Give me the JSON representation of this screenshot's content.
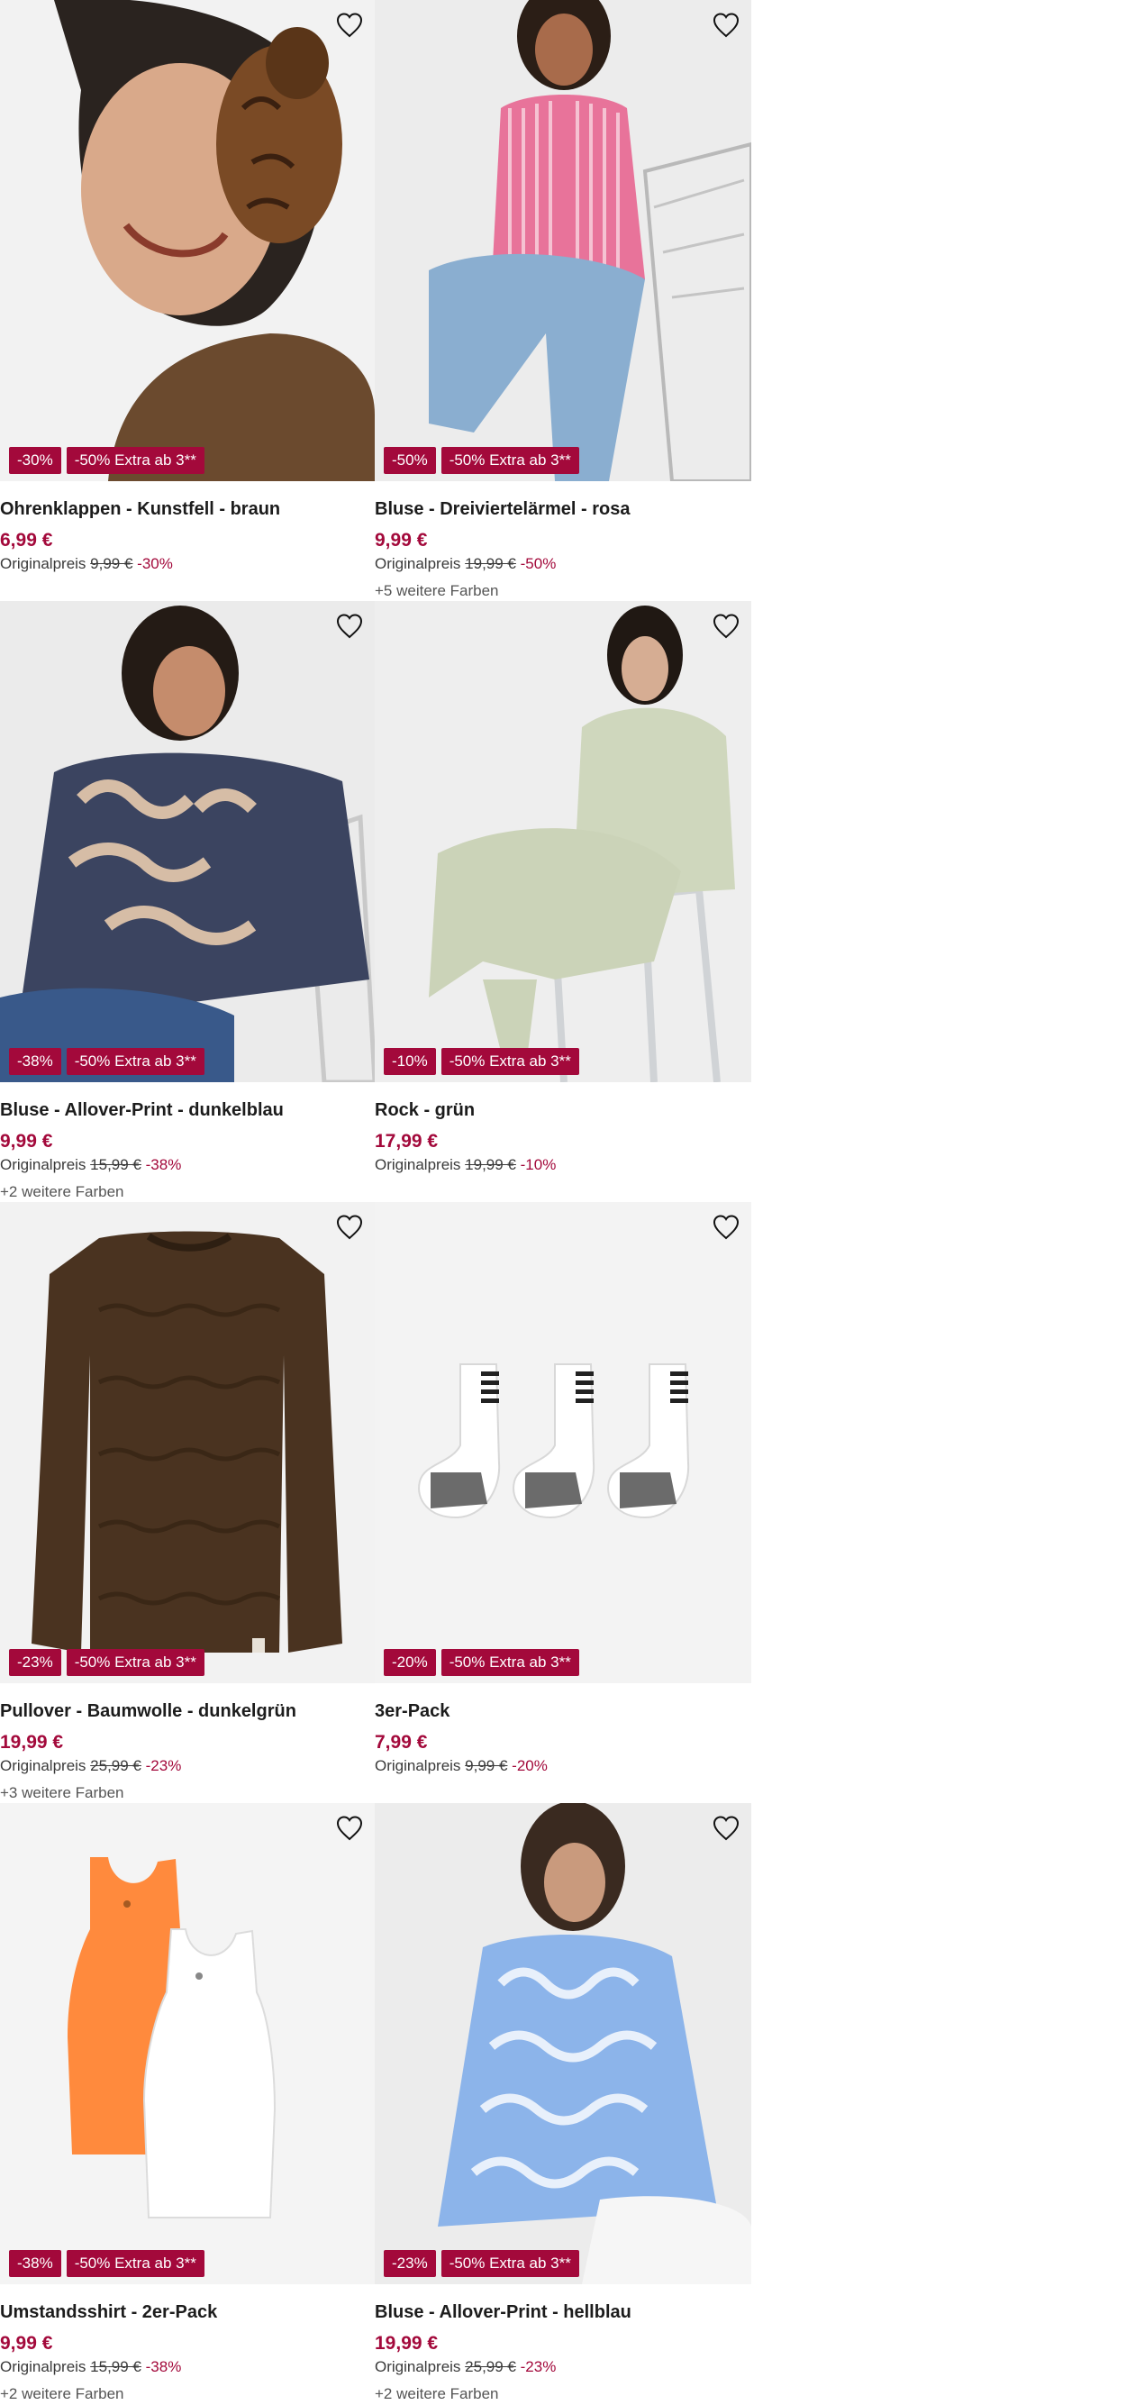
{
  "products": [
    {
      "name": "Ohrenklappen - Kunstfell - braun",
      "price": "6,99 €",
      "original_label": "Originalpreis",
      "original_price": "9,99 €",
      "discount": "-30%",
      "badges": [
        "-30%",
        "-50% Extra ab 3**"
      ],
      "colors": "",
      "image": "earmuffs-photo"
    },
    {
      "name": "Bluse - Dreiviertelärmel - rosa",
      "price": "9,99 €",
      "original_label": "Originalpreis",
      "original_price": "19,99 €",
      "discount": "-50%",
      "badges": [
        "-50%",
        "-50% Extra ab 3**"
      ],
      "colors": "+5 weitere Farben",
      "image": "pink-blouse-photo"
    },
    {
      "name": "Bluse - Allover-Print - dunkelblau",
      "price": "9,99 €",
      "original_label": "Originalpreis",
      "original_price": "15,99 €",
      "discount": "-38%",
      "badges": [
        "-38%",
        "-50% Extra ab 3**"
      ],
      "colors": "+2 weitere Farben",
      "image": "navy-print-blouse-photo"
    },
    {
      "name": "Rock - grün",
      "price": "17,99 €",
      "original_label": "Originalpreis",
      "original_price": "19,99 €",
      "discount": "-10%",
      "badges": [
        "-10%",
        "-50% Extra ab 3**"
      ],
      "colors": "",
      "image": "green-knit-skirt-photo"
    },
    {
      "name": "Pullover - Baumwolle - dunkelgrün",
      "price": "19,99 €",
      "original_label": "Originalpreis",
      "original_price": "25,99 €",
      "discount": "-23%",
      "badges": [
        "-23%",
        "-50% Extra ab 3**"
      ],
      "colors": "+3 weitere Farben",
      "image": "brown-pullover-photo"
    },
    {
      "name": "3er-Pack",
      "price": "7,99 €",
      "original_label": "Originalpreis",
      "original_price": "9,99 €",
      "discount": "-20%",
      "badges": [
        "-20%",
        "-50% Extra ab 3**"
      ],
      "colors": "",
      "image": "socks-photo"
    },
    {
      "name": "Umstandsshirt - 2er-Pack",
      "price": "9,99 €",
      "original_label": "Originalpreis",
      "original_price": "15,99 €",
      "discount": "-38%",
      "badges": [
        "-38%",
        "-50% Extra ab 3**"
      ],
      "colors": "+2 weitere Farben",
      "image": "tank-tops-photo"
    },
    {
      "name": "Bluse - Allover-Print - hellblau",
      "price": "19,99 €",
      "original_label": "Originalpreis",
      "original_price": "25,99 €",
      "discount": "-23%",
      "badges": [
        "-23%",
        "-50% Extra ab 3**"
      ],
      "colors": "+2 weitere Farben",
      "image": "light-blue-blouse-photo"
    }
  ],
  "icons": {
    "wishlist": "heart-outline-icon"
  },
  "colors": {
    "accent": "#a3093b",
    "text": "#1c1c1c",
    "muted": "#555555"
  }
}
